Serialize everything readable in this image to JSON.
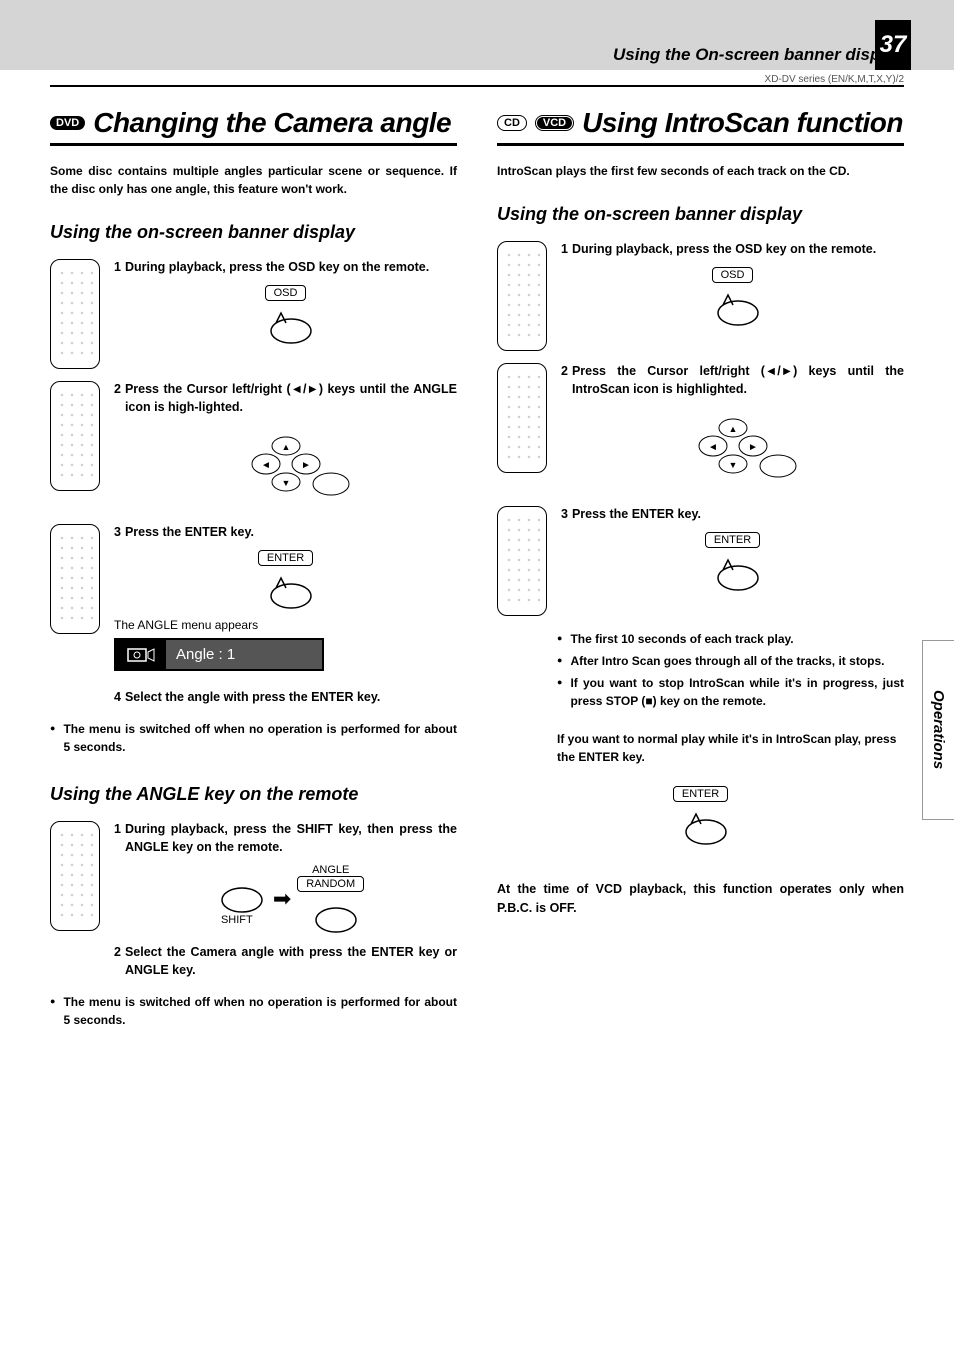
{
  "header": {
    "title": "Using the On-screen banner display",
    "page_number": "37",
    "series": "XD-DV series (EN/K,M,T,X,Y)/2"
  },
  "side_tab": "Operations",
  "left": {
    "badge": "DVD",
    "heading": "Changing the Camera angle",
    "intro": "Some disc contains multiple angles particular scene or sequence. If the disc only has one angle, this feature won't work.",
    "sub1": "Using the on-screen banner display",
    "steps1": [
      {
        "num": "1",
        "text": "During playback, press  the OSD key on the remote.",
        "key": "OSD"
      },
      {
        "num": "2",
        "text": "Press the Cursor left/right (◄/►) keys  until the ANGLE icon is high-lighted."
      },
      {
        "num": "3",
        "text": "Press the ENTER key.",
        "key": "ENTER"
      }
    ],
    "angle_caption": "The ANGLE menu appears",
    "angle_menu_text": "Angle : 1",
    "step4": {
      "num": "4",
      "text": "Select  the angle with press the ENTER key."
    },
    "note1": "The menu is switched off when no operation is performed for about 5 seconds.",
    "sub2": "Using the ANGLE key on the remote",
    "steps2_1": {
      "num": "1",
      "text": "During playback, press  the SHIFT key, then press  the ANGLE  key on the remote."
    },
    "shift_label": "SHIFT",
    "angle_label": "ANGLE",
    "random_label": "RANDOM",
    "steps2_2": {
      "num": "2",
      "text": "Select  the Camera  angle with press the ENTER key or ANGLE key."
    },
    "note2": "The menu is switched off when no operation is performed for about 5 seconds."
  },
  "right": {
    "badge_cd": "CD",
    "badge_vcd": "VCD",
    "heading": "Using IntroScan function",
    "intro": "IntroScan plays the first few seconds of each track on the CD.",
    "sub1": "Using the on-screen banner display",
    "steps": [
      {
        "num": "1",
        "text": "During playback, press  the OSD key on the remote.",
        "key": "OSD"
      },
      {
        "num": "2",
        "text": "Press the Cursor left/right (◄/►) keys until the IntroScan  icon is highlighted."
      },
      {
        "num": "3",
        "text": "Press the ENTER key.",
        "key": "ENTER"
      }
    ],
    "bullets": [
      "The first 10 seconds of each track play.",
      "After Intro Scan goes through all of the tracks, it stops.",
      "If you want to stop IntroScan while it's in progress, just press STOP (■) key on the remote."
    ],
    "note_plain": "If you want to normal play while it's in IntroScan play, press the ENTER key.",
    "enter_key": "ENTER",
    "vcd_note": "At the time of VCD playback, this function operates only when P.B.C. is OFF."
  }
}
